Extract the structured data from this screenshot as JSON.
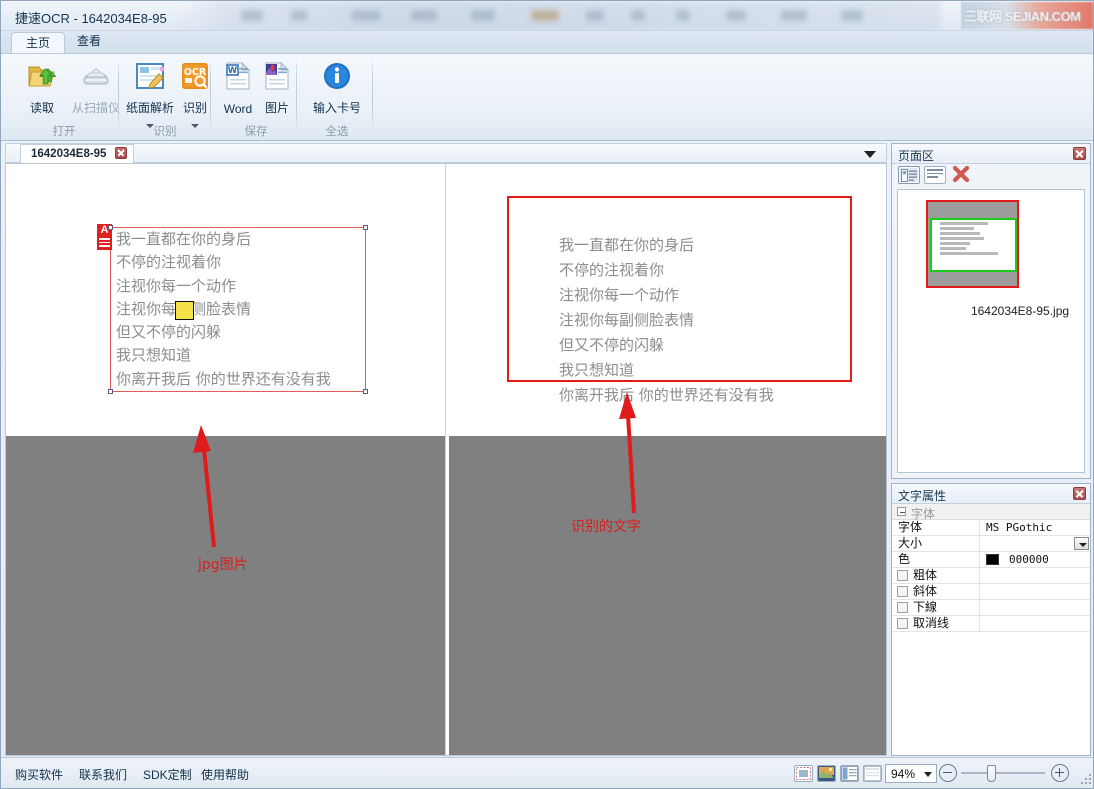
{
  "window": {
    "title": "捷速OCR - 1642034E8-95",
    "watermark": "三联网 SEJIAN.COM"
  },
  "ribbon": {
    "tabs": [
      {
        "label": "主页",
        "active": true
      },
      {
        "label": "查看",
        "active": false
      }
    ],
    "groups": [
      {
        "label": "打开",
        "buttons": [
          {
            "label": "读取",
            "icon": "open-folder-icon",
            "disabled": false,
            "caret": false
          },
          {
            "label": "从扫描仪",
            "icon": "scanner-icon",
            "disabled": true,
            "caret": false
          }
        ]
      },
      {
        "label": "识别",
        "buttons": [
          {
            "label": "纸面解析",
            "icon": "page-analysis-icon",
            "disabled": false,
            "caret": true
          },
          {
            "label": "识别",
            "icon": "ocr-icon",
            "disabled": false,
            "caret": true
          }
        ]
      },
      {
        "label": "保存",
        "buttons": [
          {
            "label": "Word",
            "icon": "word-document-icon",
            "disabled": false,
            "caret": false
          },
          {
            "label": "图片",
            "icon": "image-document-icon",
            "disabled": false,
            "caret": false
          }
        ]
      },
      {
        "label": "全选",
        "buttons": [
          {
            "label": "输入卡号",
            "icon": "info-icon",
            "disabled": false,
            "caret": false
          }
        ]
      }
    ]
  },
  "document_tabs": {
    "active_tab": "1642034E8-95",
    "close_icon": "close-icon",
    "overflow_icon": "chevron-down-icon"
  },
  "source_pane": {
    "block_badge": "A",
    "lines": [
      "我一直都在你的身后",
      "不停的注视着你",
      "注视你每一个动作",
      "注视你每副侧脸表情",
      "但又不停的闪躲",
      "我只想知道",
      "你离开我后 你的世界还有没有我"
    ],
    "annotation": "jpg图片"
  },
  "result_pane": {
    "lines": [
      "我一直都在你的身后",
      "不停的注视着你",
      "注视你每一个动作",
      "注视你每副侧脸表情",
      "但又不停的闪躲",
      "我只想知道",
      "你离开我后 你的世界还有没有我"
    ],
    "annotation": "识别的文字"
  },
  "pages_panel": {
    "title": "页面区",
    "close_icon": "close-icon",
    "tools": [
      {
        "name": "thumbnail-view-button",
        "selected": true
      },
      {
        "name": "list-view-button",
        "selected": false
      },
      {
        "name": "delete-page-button",
        "glyph": "✕"
      }
    ],
    "thumbnail_label": "1642034E8-95.jpg"
  },
  "properties_panel": {
    "title": "文字属性",
    "close_icon": "close-icon",
    "group_label": "字体",
    "rows": [
      {
        "key": "字体",
        "value": "MS PGothic",
        "type": "text"
      },
      {
        "key": "大小",
        "value": "",
        "type": "dropdown"
      },
      {
        "key": "色",
        "value": "000000",
        "type": "color",
        "swatch": "#000000"
      },
      {
        "key": "粗体",
        "value": "",
        "type": "checkbox",
        "checked": false
      },
      {
        "key": "斜体",
        "value": "",
        "type": "checkbox",
        "checked": false
      },
      {
        "key": "下線",
        "value": "",
        "type": "checkbox",
        "checked": false
      },
      {
        "key": "取消线",
        "value": "",
        "type": "checkbox",
        "checked": false
      }
    ]
  },
  "statusbar": {
    "links": [
      "购买软件",
      "联系我们",
      "SDK定制",
      "使用帮助"
    ],
    "view_buttons": [
      "page-view-button",
      "image-view-button",
      "split-view-button",
      "text-view-button"
    ],
    "zoom_value": "94%",
    "zoom_out_icon": "zoom-out-icon",
    "zoom_in_icon": "zoom-in-icon"
  },
  "colors": {
    "accent_red": "#e01b1b",
    "selection_yellow": "#f5e14a",
    "thumbnail_green": "#19cc19",
    "pane_background": "#808080"
  }
}
